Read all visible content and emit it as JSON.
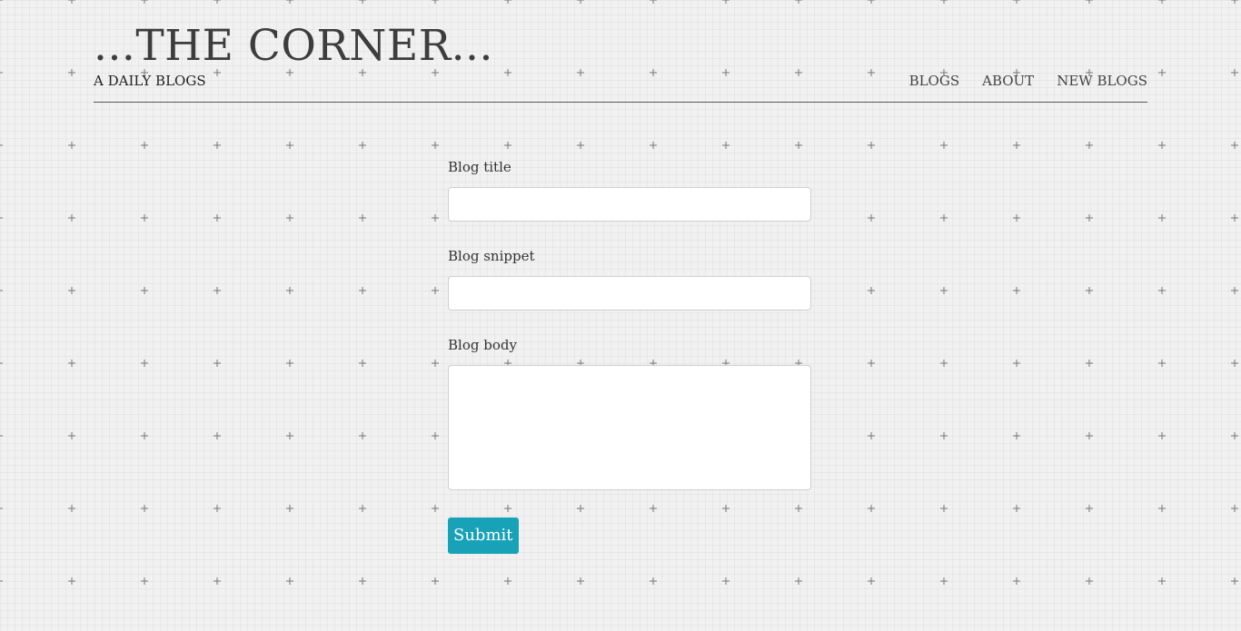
{
  "header": {
    "site_title": "...THE CORNER...",
    "tagline": "A DAILY BLOGS",
    "nav": [
      {
        "label": "BLOGS"
      },
      {
        "label": "ABOUT"
      },
      {
        "label": "NEW BLOGS"
      }
    ]
  },
  "form": {
    "title_label": "Blog title",
    "title_value": "",
    "snippet_label": "Blog snippet",
    "snippet_value": "",
    "body_label": "Blog body",
    "body_value": "",
    "submit_label": "Submit"
  },
  "colors": {
    "background": "#f1f1f1",
    "text": "#3d3d3d",
    "accent": "#17a2b8",
    "input_border": "#cfcfcf"
  }
}
